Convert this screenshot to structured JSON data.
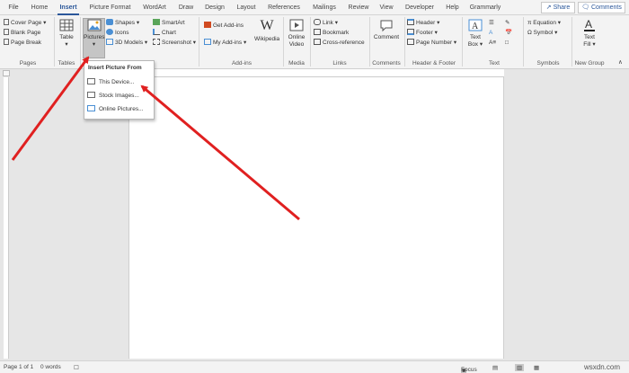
{
  "tabs": [
    "File",
    "Home",
    "Insert",
    "Picture Format",
    "WordArt",
    "Draw",
    "Design",
    "Layout",
    "References",
    "Mailings",
    "Review",
    "View",
    "Developer",
    "Help",
    "Grammarly"
  ],
  "active_tab": "Insert",
  "share_label": "Share",
  "comments_label": "Comments",
  "ribbon": {
    "pages": {
      "items": [
        "Cover Page",
        "Blank Page",
        "Page Break"
      ],
      "label": "Pages"
    },
    "tables": {
      "table_label": "Table",
      "label": "Tables"
    },
    "illustrations": {
      "pictures_label": "Pictures",
      "col1": [
        "Shapes",
        "Icons",
        "3D Models"
      ],
      "col2": [
        "SmartArt",
        "Chart",
        "Screenshot"
      ]
    },
    "addins": {
      "get_addins": "Get Add-ins",
      "my_addins": "My Add-ins",
      "wikipedia": "Wikipedia",
      "label": "Add-ins"
    },
    "media": {
      "online_video_l1": "Online",
      "online_video_l2": "Video",
      "label": "Media"
    },
    "links": {
      "items": [
        "Link",
        "Bookmark",
        "Cross-reference"
      ],
      "label": "Links"
    },
    "comments": {
      "comment": "Comment",
      "label": "Comments"
    },
    "header_footer": {
      "items": [
        "Header",
        "Footer",
        "Page Number"
      ],
      "label": "Header & Footer"
    },
    "text": {
      "textbox_l1": "Text",
      "textbox_l2": "Box",
      "label": "Text"
    },
    "symbols": {
      "items": [
        "Equation",
        "Symbol"
      ],
      "label": "Symbols"
    },
    "new_group": {
      "textfill_l1": "Text",
      "textfill_l2": "Fill",
      "label": "New Group"
    }
  },
  "dropdown": {
    "header": "Insert Picture From",
    "items": [
      "This Device...",
      "Stock Images...",
      "Online Pictures..."
    ]
  },
  "status": {
    "page": "Page 1 of 1",
    "words": "0 words",
    "focus": "Focus"
  },
  "watermark": "wsxdn.com",
  "colors": {
    "accent": "#2b579a",
    "arrow": "#e02020"
  }
}
